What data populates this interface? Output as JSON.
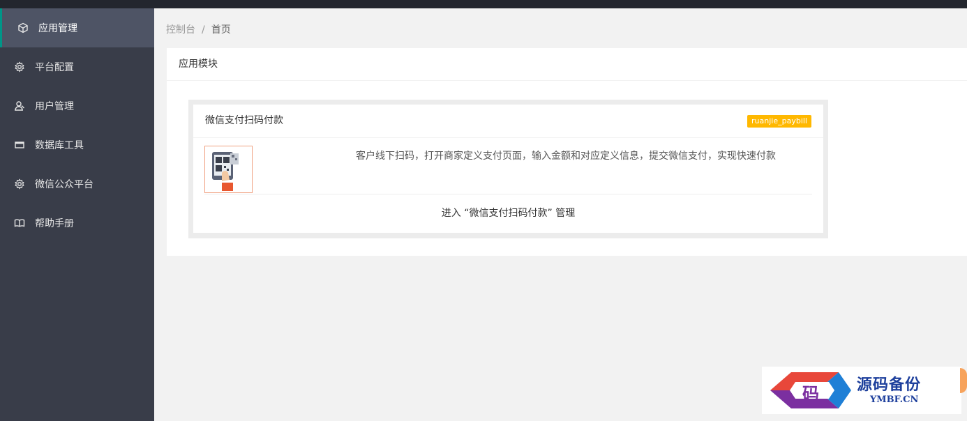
{
  "sidebar": {
    "items": [
      {
        "label": "应用管理",
        "icon": "cube-icon",
        "active": true
      },
      {
        "label": "平台配置",
        "icon": "gear-icon"
      },
      {
        "label": "用户管理",
        "icon": "user-icon"
      },
      {
        "label": "数据库工具",
        "icon": "window-icon"
      },
      {
        "label": "微信公众平台",
        "icon": "gear-icon"
      },
      {
        "label": "帮助手册",
        "icon": "book-icon"
      }
    ]
  },
  "breadcrumb": {
    "root": "控制台",
    "separator": "/",
    "current": "首页"
  },
  "panel": {
    "title": "应用模块"
  },
  "app_card": {
    "title": "微信支付扫码付款",
    "badge": "ruanjie_paybill",
    "description": "客户线下扫码，打开商家定义支付页面，输入金额和对应定义信息，提交微信支付，实现快速付款",
    "enter_link": "进入 “微信支付扫码付款” 管理",
    "thumbnail_icon": "qr-payment-icon"
  },
  "watermark": {
    "logo_char": "码",
    "name": "源码备份",
    "domain": "YMBF.CN"
  },
  "colors": {
    "sidebar_bg": "#393d49",
    "sidebar_active_bg": "#4e5465",
    "accent": "#009688",
    "badge": "#ffb800",
    "topbar": "#23262e"
  }
}
